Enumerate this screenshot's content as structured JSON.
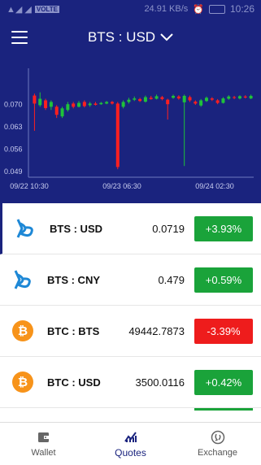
{
  "status_bar": {
    "speed": "24.91 KB/s",
    "time": "10:26",
    "network": "VOLTE"
  },
  "header": {
    "title": "BTS : USD"
  },
  "chart_data": {
    "type": "candlestick",
    "x_ticks": [
      "09/22 10:30",
      "09/23 06:30",
      "09/24 02:30"
    ],
    "y_ticks": [
      "0.070",
      "0.063",
      "0.056",
      "0.049"
    ],
    "ylim": [
      0.047,
      0.08
    ],
    "series": [
      {
        "o": 0.0725,
        "c": 0.07,
        "h": 0.0731,
        "l": 0.0615,
        "up": false
      },
      {
        "o": 0.0695,
        "c": 0.0715,
        "h": 0.0735,
        "l": 0.069,
        "up": true
      },
      {
        "o": 0.071,
        "c": 0.0686,
        "h": 0.0715,
        "l": 0.068,
        "up": false
      },
      {
        "o": 0.069,
        "c": 0.0705,
        "h": 0.071,
        "l": 0.068,
        "up": true
      },
      {
        "o": 0.069,
        "c": 0.0665,
        "h": 0.0695,
        "l": 0.0655,
        "up": false
      },
      {
        "o": 0.066,
        "c": 0.0685,
        "h": 0.069,
        "l": 0.0655,
        "up": true
      },
      {
        "o": 0.068,
        "c": 0.0698,
        "h": 0.0705,
        "l": 0.0675,
        "up": true
      },
      {
        "o": 0.07,
        "c": 0.069,
        "h": 0.0705,
        "l": 0.0685,
        "up": false
      },
      {
        "o": 0.069,
        "c": 0.0702,
        "h": 0.0708,
        "l": 0.0688,
        "up": true
      },
      {
        "o": 0.0705,
        "c": 0.0692,
        "h": 0.071,
        "l": 0.0688,
        "up": false
      },
      {
        "o": 0.0695,
        "c": 0.07,
        "h": 0.0705,
        "l": 0.069,
        "up": true
      },
      {
        "o": 0.07,
        "c": 0.0696,
        "h": 0.0705,
        "l": 0.0694,
        "up": false
      },
      {
        "o": 0.0698,
        "c": 0.0702,
        "h": 0.0705,
        "l": 0.0696,
        "up": true
      },
      {
        "o": 0.07,
        "c": 0.0705,
        "h": 0.0708,
        "l": 0.0698,
        "up": true
      },
      {
        "o": 0.0705,
        "c": 0.07,
        "h": 0.0708,
        "l": 0.0697,
        "up": false
      },
      {
        "o": 0.07,
        "c": 0.0502,
        "h": 0.0705,
        "l": 0.0495,
        "up": false
      },
      {
        "o": 0.069,
        "c": 0.0705,
        "h": 0.071,
        "l": 0.0685,
        "up": true
      },
      {
        "o": 0.0705,
        "c": 0.0712,
        "h": 0.0718,
        "l": 0.07,
        "up": true
      },
      {
        "o": 0.0712,
        "c": 0.0716,
        "h": 0.0722,
        "l": 0.0708,
        "up": true
      },
      {
        "o": 0.0714,
        "c": 0.0708,
        "h": 0.0718,
        "l": 0.0705,
        "up": false
      },
      {
        "o": 0.0706,
        "c": 0.072,
        "h": 0.0725,
        "l": 0.0703,
        "up": true
      },
      {
        "o": 0.0718,
        "c": 0.0714,
        "h": 0.0724,
        "l": 0.0712,
        "up": false
      },
      {
        "o": 0.0715,
        "c": 0.0723,
        "h": 0.0728,
        "l": 0.0713,
        "up": true
      },
      {
        "o": 0.072,
        "c": 0.0714,
        "h": 0.0724,
        "l": 0.071,
        "up": false
      },
      {
        "o": 0.0712,
        "c": 0.0698,
        "h": 0.0715,
        "l": 0.065,
        "up": false
      },
      {
        "o": 0.0718,
        "c": 0.0724,
        "h": 0.0728,
        "l": 0.0715,
        "up": true
      },
      {
        "o": 0.0722,
        "c": 0.0716,
        "h": 0.0726,
        "l": 0.0712,
        "up": false
      },
      {
        "o": 0.0704,
        "c": 0.0724,
        "h": 0.0728,
        "l": 0.0505,
        "up": true
      },
      {
        "o": 0.072,
        "c": 0.071,
        "h": 0.0725,
        "l": 0.0705,
        "up": false
      },
      {
        "o": 0.0706,
        "c": 0.07,
        "h": 0.071,
        "l": 0.0696,
        "up": false
      },
      {
        "o": 0.0694,
        "c": 0.071,
        "h": 0.0714,
        "l": 0.069,
        "up": true
      },
      {
        "o": 0.0708,
        "c": 0.0718,
        "h": 0.0722,
        "l": 0.0705,
        "up": true
      },
      {
        "o": 0.0716,
        "c": 0.0712,
        "h": 0.072,
        "l": 0.0708,
        "up": false
      },
      {
        "o": 0.071,
        "c": 0.0702,
        "h": 0.0714,
        "l": 0.0698,
        "up": false
      },
      {
        "o": 0.0702,
        "c": 0.0716,
        "h": 0.072,
        "l": 0.07,
        "up": true
      },
      {
        "o": 0.0715,
        "c": 0.0722,
        "h": 0.0726,
        "l": 0.0712,
        "up": true
      },
      {
        "o": 0.072,
        "c": 0.0718,
        "h": 0.0724,
        "l": 0.0714,
        "up": false
      },
      {
        "o": 0.0716,
        "c": 0.0723,
        "h": 0.0726,
        "l": 0.0713,
        "up": true
      },
      {
        "o": 0.0722,
        "c": 0.0719,
        "h": 0.0726,
        "l": 0.0716,
        "up": false
      },
      {
        "o": 0.0716,
        "c": 0.0724,
        "h": 0.0728,
        "l": 0.0714,
        "up": true
      }
    ]
  },
  "quotes": [
    {
      "pair": "BTS : USD",
      "price": "0.0719",
      "change": "+3.93%",
      "change_color": "#1aa33a",
      "icon": "bitshares-icon",
      "icon_color": "#1e88d6"
    },
    {
      "pair": "BTS : CNY",
      "price": "0.479",
      "change": "+0.59%",
      "change_color": "#1aa33a",
      "icon": "bitshares-icon",
      "icon_color": "#1e88d6"
    },
    {
      "pair": "BTC : BTS",
      "price": "49442.7873",
      "change": "-3.39%",
      "change_color": "#ee1c1c",
      "icon": "bitcoin-icon",
      "icon_color": "#f7931a"
    },
    {
      "pair": "BTC : USD",
      "price": "3500.0116",
      "change": "+0.42%",
      "change_color": "#1aa33a",
      "icon": "bitcoin-icon",
      "icon_color": "#f7931a"
    }
  ],
  "tabs": [
    {
      "label": "Wallet",
      "icon": "wallet-icon"
    },
    {
      "label": "Quotes",
      "icon": "chart-icon"
    },
    {
      "label": "Exchange",
      "icon": "exchange-icon"
    }
  ],
  "colors": {
    "primary": "#1a237e",
    "up": "#1aa33a",
    "down": "#ee1c1c"
  }
}
